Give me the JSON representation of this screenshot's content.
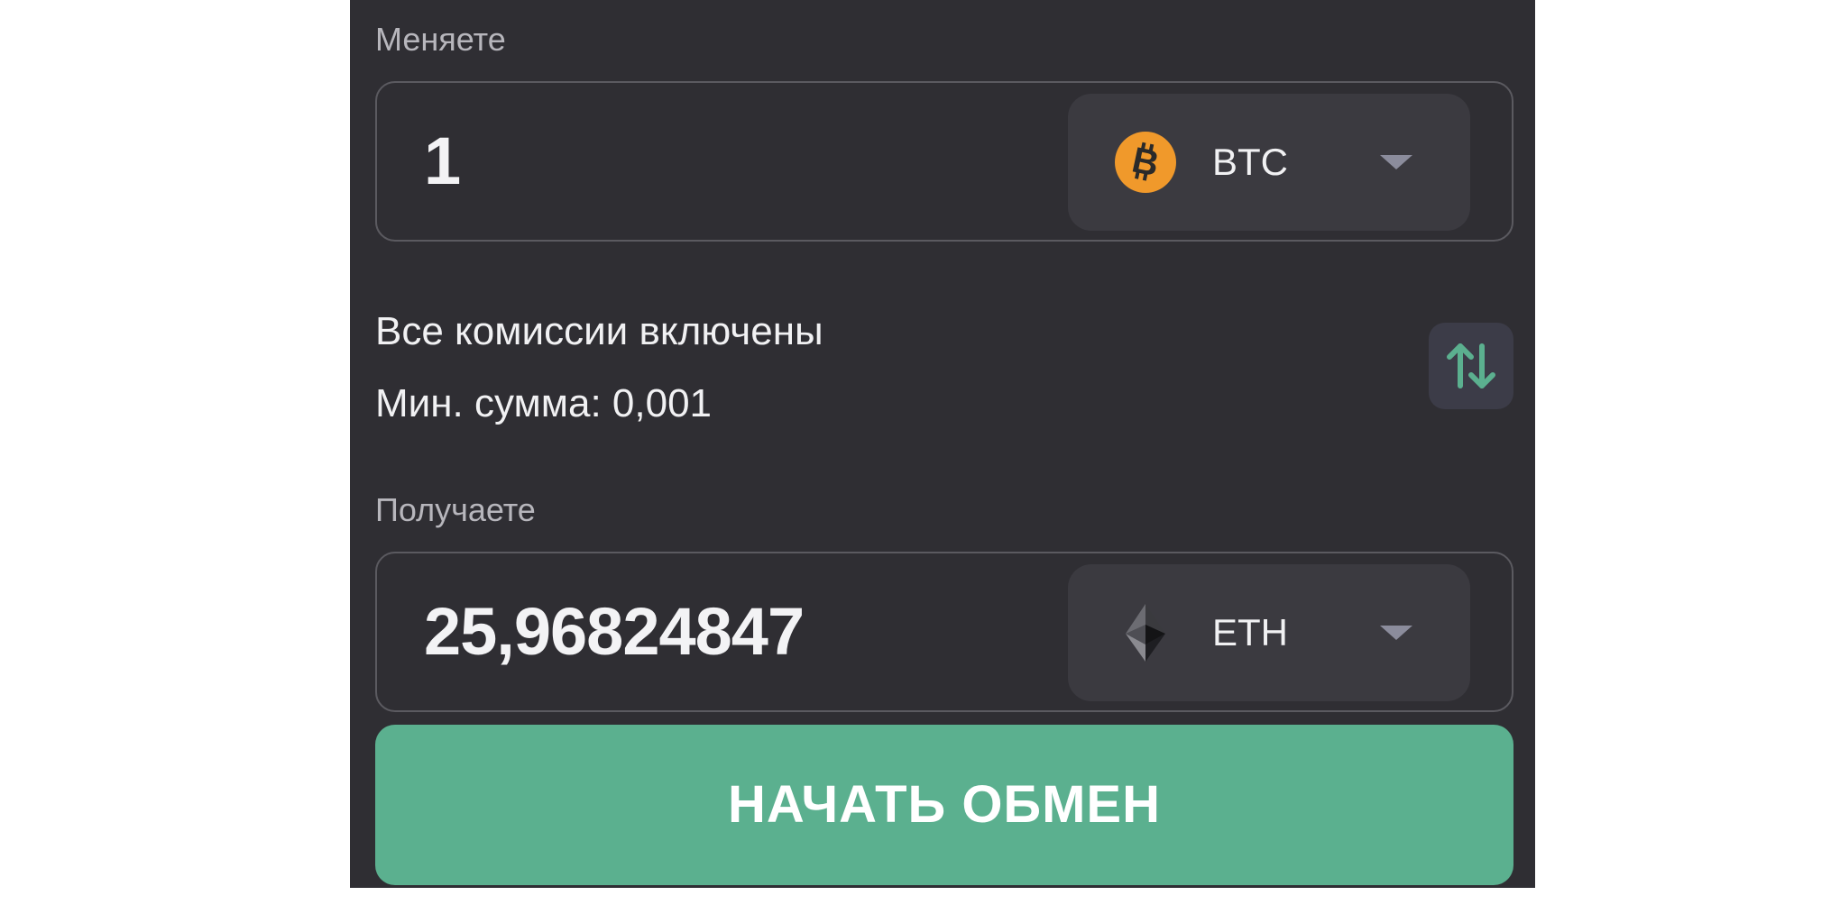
{
  "send": {
    "label": "Меняете",
    "amount": "1",
    "currency": "BTC",
    "currency_icon": "bitcoin-icon",
    "icon_color": "#f0992b"
  },
  "info": {
    "fees_text": "Все комиссии включены",
    "min_amount_text": "Мин. сумма: 0,001"
  },
  "swap": {
    "icon": "swap-arrows-icon",
    "icon_color": "#5bb08f"
  },
  "receive": {
    "label": "Получаете",
    "amount": "25,96824847",
    "currency": "ETH",
    "currency_icon": "ethereum-icon"
  },
  "action": {
    "start_label": "НАЧАТЬ ОБМЕН",
    "color": "#5bb08f"
  },
  "colors": {
    "panel_bg": "#2f2e33",
    "select_bg": "#3b3a40",
    "accent": "#5bb08f"
  }
}
